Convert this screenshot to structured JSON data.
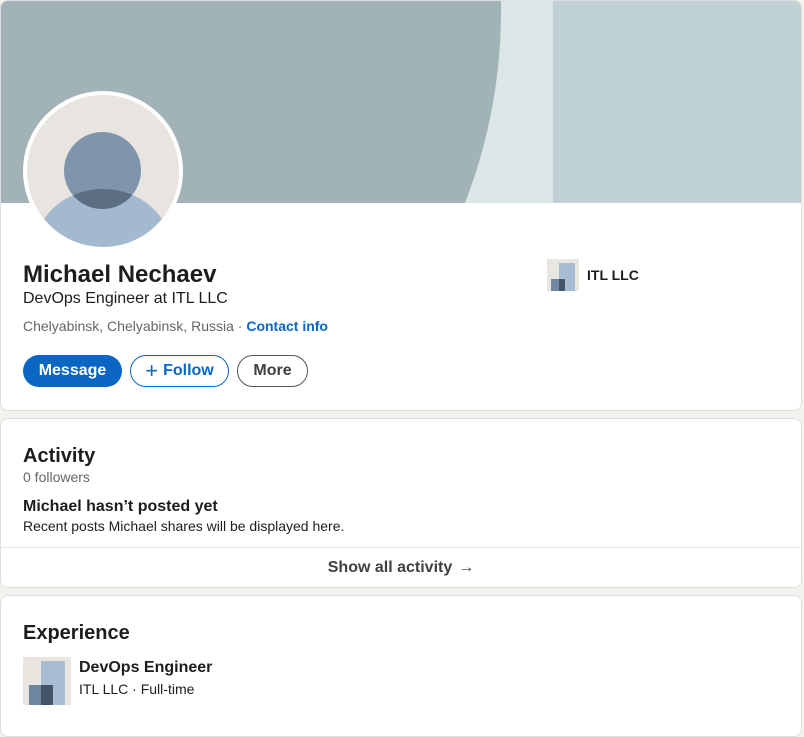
{
  "profile": {
    "name": "Michael Nechaev",
    "headline": "DevOps Engineer at ITL LLC",
    "location": "Chelyabinsk, Chelyabinsk, Russia",
    "separator": " · ",
    "contact_info_label": "Contact info",
    "current_company": "ITL LLC",
    "actions": {
      "message_label": "Message",
      "follow_icon": "+",
      "follow_label": "Follow",
      "more_label": "More"
    }
  },
  "activity": {
    "title": "Activity",
    "followers": "0 followers",
    "empty_title": "Michael hasn’t posted yet",
    "empty_subtitle": "Recent posts Michael shares will be displayed here.",
    "show_all_label": "Show all activity",
    "show_all_arrow": "→"
  },
  "experience": {
    "title": "Experience",
    "items": [
      {
        "role": "DevOps Engineer",
        "company_line": "ITL LLC · Full-time"
      }
    ]
  },
  "icons": {
    "avatar": "default-person-avatar",
    "company_logo": "company-placeholder-logo",
    "arrow": "arrow-right-icon",
    "plus": "plus-icon"
  },
  "colors": {
    "primary": "#0a66c2",
    "banner": "#a1b3b6",
    "page_background": "#f4f2ee"
  }
}
